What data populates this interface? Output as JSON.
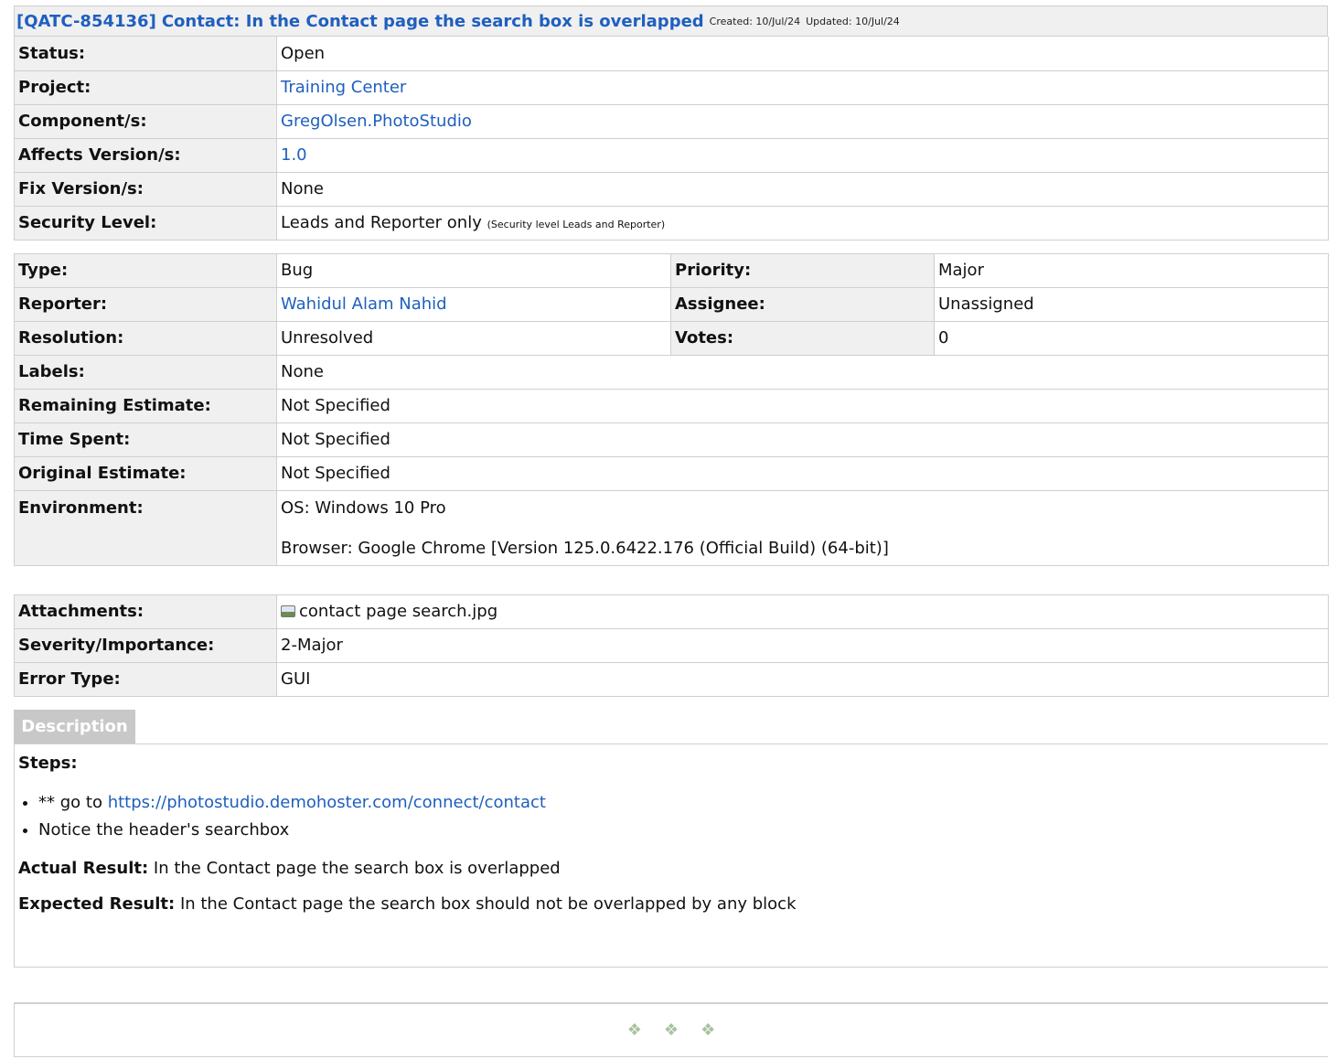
{
  "header": {
    "key": "[QATC-854136]",
    "summary": "Contact: In the Contact page the search box is overlapped",
    "created": "Created: 10/Jul/24",
    "updated": "Updated: 10/Jul/24"
  },
  "details": {
    "status_label": "Status:",
    "status": "Open",
    "project_label": "Project:",
    "project": "Training Center",
    "component_label": "Component/s:",
    "component": "GregOlsen.PhotoStudio",
    "affects_label": "Affects Version/s:",
    "affects": "1.0",
    "fix_label": "Fix Version/s:",
    "fix": "None",
    "security_label": "Security Level:",
    "security": "Leads and Reporter only",
    "security_note": "(Security level Leads and Reporter)"
  },
  "people": {
    "type_label": "Type:",
    "type": "Bug",
    "priority_label": "Priority:",
    "priority": "Major",
    "reporter_label": "Reporter:",
    "reporter": "Wahidul Alam Nahid",
    "assignee_label": "Assignee:",
    "assignee": "Unassigned",
    "resolution_label": "Resolution:",
    "resolution": "Unresolved",
    "votes_label": "Votes:",
    "votes": "0",
    "labels_label": "Labels:",
    "labels": "None",
    "remaining_label": "Remaining Estimate:",
    "remaining": "Not Specified",
    "spent_label": "Time Spent:",
    "spent": "Not Specified",
    "original_label": "Original Estimate:",
    "original": "Not Specified",
    "env_label": "Environment:",
    "env_os": "OS: Windows 10 Pro",
    "env_browser": "Browser: Google Chrome [Version 125.0.6422.176 (Official Build) (64-bit)]"
  },
  "extra": {
    "attachments_label": "Attachments:",
    "attachment_file": "contact page search.jpg",
    "severity_label": "Severity/Importance:",
    "severity": "2-Major",
    "error_label": "Error Type:",
    "error": "GUI"
  },
  "description": {
    "tab": "Description",
    "steps": "Steps:",
    "step1_prefix": "** go to ",
    "step1_link": "https://photostudio.demohoster.com/connect/contact",
    "step2": "Notice the header's searchbox",
    "actual_label": "Actual Result:",
    "actual": "In the Contact page the search box is overlapped",
    "expected_label": "Expected Result:",
    "expected": "In the Contact page the search box should not be  overlapped by any block"
  },
  "footer": {
    "ornament": "❖"
  },
  "colors": {
    "link": "#1f5fbf",
    "label_bg": "#f0f0f0",
    "tab_bg": "#c8c8c8",
    "border": "#cfcfcf"
  }
}
